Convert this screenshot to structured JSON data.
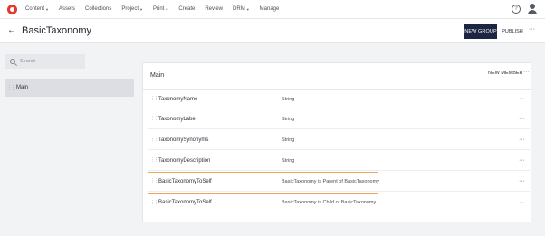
{
  "nav": {
    "items": [
      {
        "label": "Content",
        "has_caret": true
      },
      {
        "label": "Assets",
        "has_caret": false
      },
      {
        "label": "Collections",
        "has_caret": false
      },
      {
        "label": "Project",
        "has_caret": true
      },
      {
        "label": "Print",
        "has_caret": true
      },
      {
        "label": "Create",
        "has_caret": false
      },
      {
        "label": "Review",
        "has_caret": false
      },
      {
        "label": "DRM",
        "has_caret": true
      },
      {
        "label": "Manage",
        "has_caret": false
      }
    ],
    "help_glyph": "?",
    "icons": [
      "logo-icon",
      "help-icon",
      "user-icon"
    ]
  },
  "header": {
    "title": "BasicTaxonomy",
    "new_group_label": "NEW GROUP",
    "publish_label": "PUBLISH",
    "more_glyph": "···"
  },
  "sidebar": {
    "search_placeholder": "Search",
    "items": [
      {
        "label": "Main"
      }
    ]
  },
  "panel": {
    "title": "Main",
    "new_member_label": "NEW MEMBER",
    "more_glyph": "···",
    "rows": [
      {
        "name": "TaxonomyName",
        "type": "String"
      },
      {
        "name": "TaxonomyLabel",
        "type": "String"
      },
      {
        "name": "TaxonomySynonyms",
        "type": "String"
      },
      {
        "name": "TaxonomyDescription",
        "type": "String"
      },
      {
        "name": "BasicTaxonomyToSelf",
        "type": "BasicTaxonomy is Parent of BasicTaxonomy"
      },
      {
        "name": "BasicTaxonomyToSelf",
        "type": "BasicTaxonomy is Child of BasicTaxonomy"
      }
    ],
    "selected_row_index": 4
  },
  "colors": {
    "accent": "#1c2541",
    "logo": "#e8382e",
    "selection_border": "#f0a45c",
    "background": "#f2f3f5"
  }
}
